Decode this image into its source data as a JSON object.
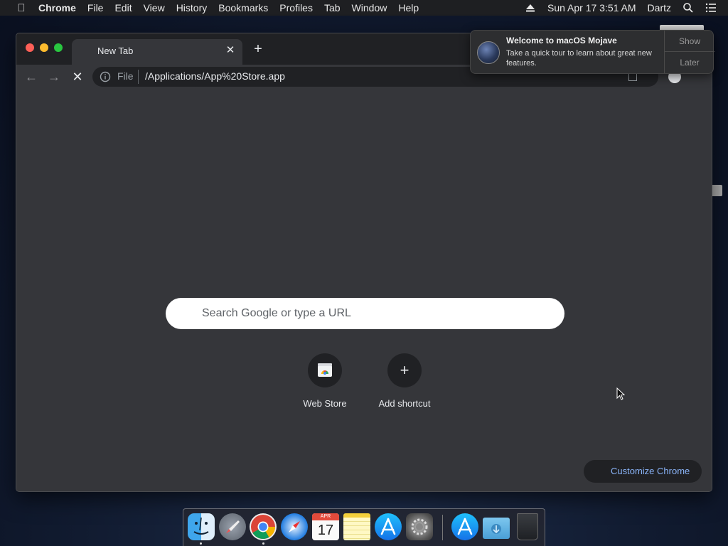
{
  "menubar": {
    "app_name": "Chrome",
    "items": [
      "File",
      "Edit",
      "View",
      "History",
      "Bookmarks",
      "Profiles",
      "Tab",
      "Window",
      "Help"
    ],
    "datetime": "Sun Apr 17  3:51 AM",
    "user": "Dartz"
  },
  "browser": {
    "tab_title": "New Tab",
    "address_scheme": "File",
    "address_url": "/Applications/App%20Store.app",
    "search_placeholder": "Search Google or type a URL",
    "shortcuts": [
      {
        "label": "Web Store",
        "icon": "web-store-icon"
      },
      {
        "label": "Add shortcut",
        "icon": "plus-icon"
      }
    ],
    "customize_label": "Customize Chrome"
  },
  "notification": {
    "title": "Welcome to macOS Mojave",
    "body": "Take a quick tour to learn about great new features.",
    "show_label": "Show",
    "later_label": "Later"
  },
  "dock": {
    "apps": [
      "Finder",
      "Launchpad",
      "Google Chrome",
      "Safari",
      "Calendar",
      "Notes",
      "App Store",
      "System Preferences",
      "App Store",
      "Downloads",
      "Trash"
    ],
    "calendar_month": "APR",
    "calendar_day": "17",
    "running": [
      "Finder",
      "Google Chrome"
    ]
  },
  "colors": {
    "window_bg": "#35363a",
    "tabstrip_bg": "#202124",
    "link_blue": "#8ab4f8",
    "traffic_red": "#fd5f57",
    "traffic_yellow": "#fcbb2e",
    "traffic_green": "#29c640"
  }
}
